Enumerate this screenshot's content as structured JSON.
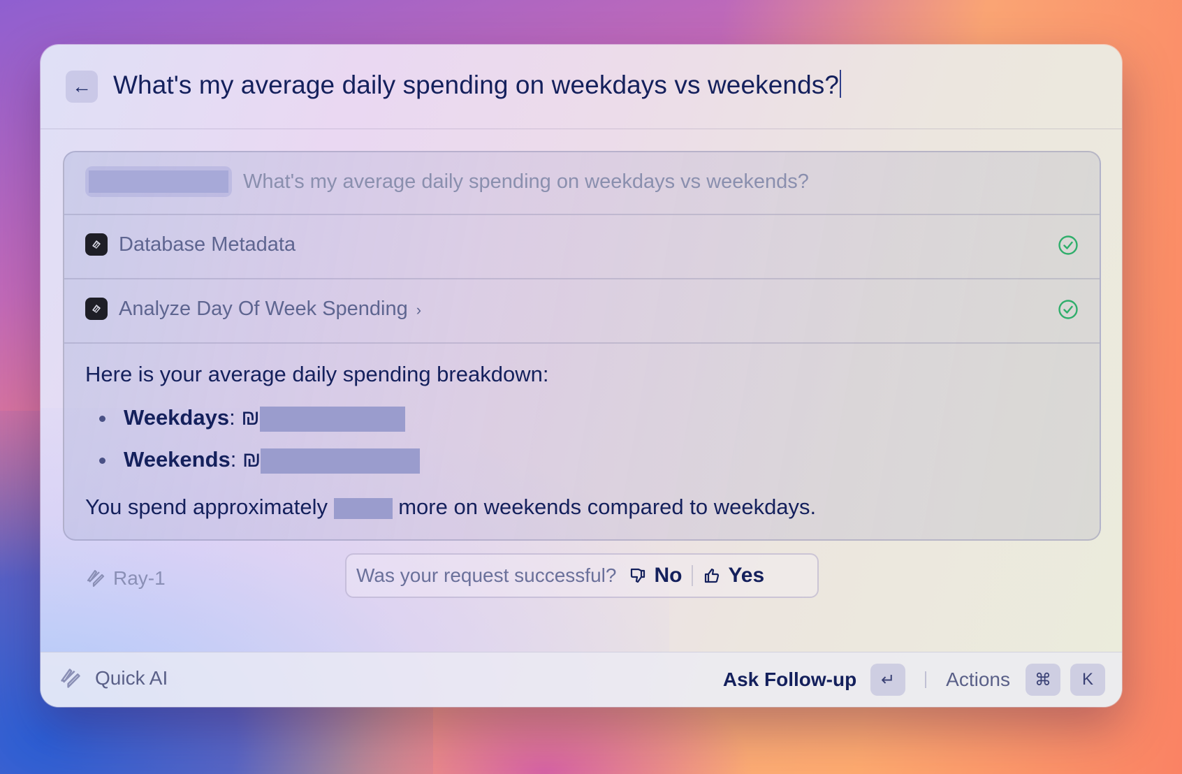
{
  "header": {
    "query": "What's my average daily spending on weekdays vs weekends?"
  },
  "panel": {
    "user_query": "What's my average daily spending on weekdays vs weekends?",
    "tools": [
      {
        "label": "Database Metadata",
        "status": "complete"
      },
      {
        "label": "Analyze Day Of Week Spending",
        "status": "complete"
      }
    ],
    "answer": {
      "intro": "Here is your average daily spending breakdown:",
      "bullets": [
        {
          "label": "Weekdays",
          "sep": ":",
          "currency": "₪"
        },
        {
          "label": "Weekends",
          "sep": ":",
          "currency": "₪"
        }
      ],
      "outro_before": "You spend approximately",
      "outro_after": "more on weekends compared to weekdays."
    }
  },
  "feedback": {
    "model": "Ray-1",
    "question": "Was your request successful?",
    "no_label": "No",
    "yes_label": "Yes"
  },
  "footer": {
    "app_name": "Quick AI",
    "ask_label": "Ask Follow-up",
    "enter_key": "↵",
    "actions_label": "Actions",
    "cmd_key": "⌘",
    "k_key": "K"
  },
  "colors": {
    "text_primary": "#14205c",
    "success_green": "#2fae6b",
    "redaction": "#9a9ccd"
  }
}
